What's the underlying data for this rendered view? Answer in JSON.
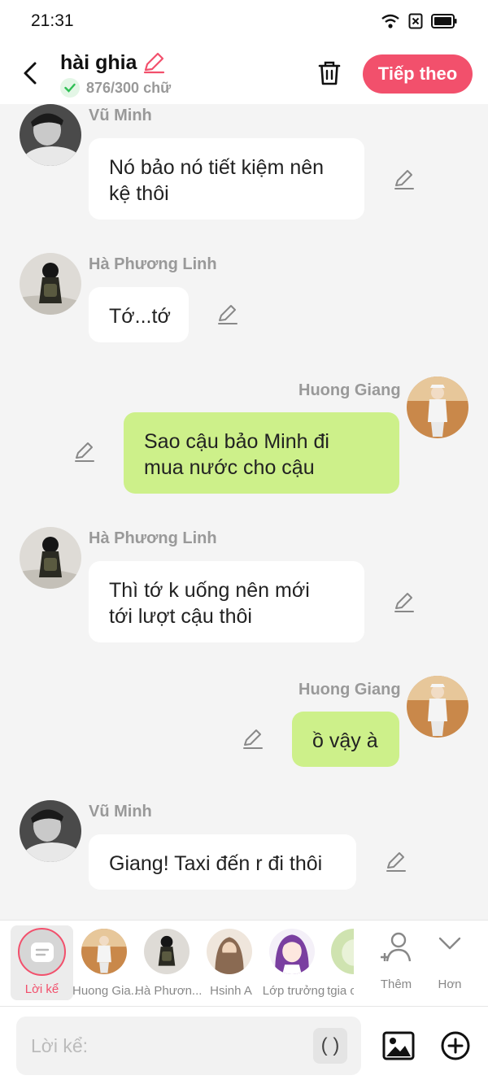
{
  "status_bar": {
    "time": "21:31"
  },
  "header": {
    "title": "hài ghia",
    "word_count": "876/300 chữ",
    "next_label": "Tiếp theo"
  },
  "messages": [
    {
      "sender": "Vũ Minh",
      "text_lines": [
        "Nó bảo nó tiết kiệm nên",
        "kệ thôi"
      ],
      "side": "left"
    },
    {
      "sender": "Hà Phương Linh",
      "text_lines": [
        "Tớ...tớ"
      ],
      "side": "left"
    },
    {
      "sender": "Huong Giang",
      "text_lines": [
        "Sao cậu bảo Minh đi",
        "mua nước cho cậu"
      ],
      "side": "right"
    },
    {
      "sender": "Hà Phương Linh",
      "text_lines": [
        "Thì tớ k uống nên mới",
        "tới lượt cậu thôi"
      ],
      "side": "left"
    },
    {
      "sender": "Huong Giang",
      "text_lines": [
        "ồ vậy à"
      ],
      "side": "right"
    },
    {
      "sender": "Vũ Minh",
      "text_lines": [
        "Giang! Taxi đến r đi thôi"
      ],
      "side": "left"
    }
  ],
  "characters": {
    "narration_label": "Lời kể",
    "items": [
      {
        "label": "Huong Gia..."
      },
      {
        "label": "Hà Phươn..."
      },
      {
        "label": "Hsinh A"
      },
      {
        "label": "Lớp trưởng"
      },
      {
        "label": "tgia c"
      }
    ],
    "add_label": "Thêm",
    "more_label": "Hơn"
  },
  "input": {
    "placeholder": "Lời kể:",
    "paren_label": "( )"
  },
  "colors": {
    "accent": "#f2506c",
    "right_bubble": "#cdf08a",
    "left_bubble": "#ffffff"
  }
}
